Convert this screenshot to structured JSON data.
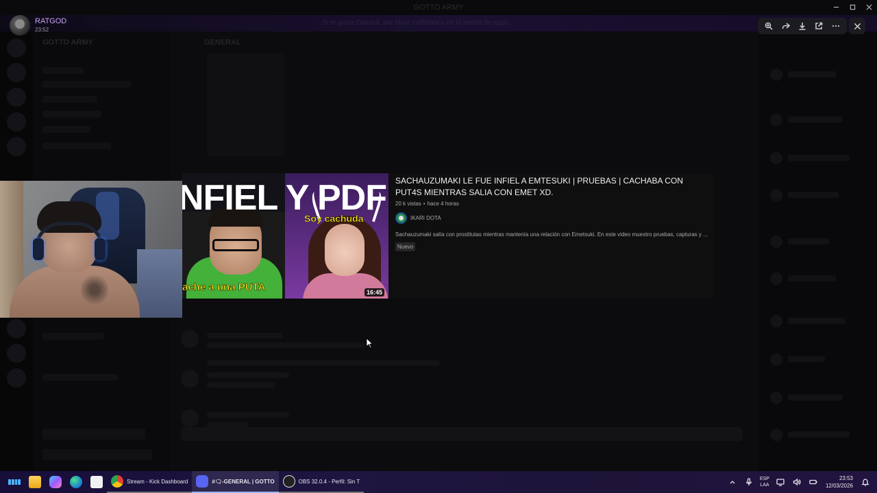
{
  "window": {
    "app_title": "GOTTO ARMY"
  },
  "background": {
    "server_name": "GOTTO ARMY",
    "channel_header": "GENERAL",
    "notice_text": "Si te gusta Discord, por favor calíficanos en la tienda de apps"
  },
  "viewer": {
    "username": "RATGOD",
    "time": "23:52",
    "toolbar": [
      "zoom-in-icon",
      "forward-icon",
      "download-icon",
      "open-external-icon",
      "more-icon"
    ]
  },
  "video": {
    "title": "SACHAUZUMAKI LE FUE INFIEL A EMTESUKI | PRUEBAS | CACHABA CON PUT4S MIENTRAS SALIA CON EMET XD.",
    "views": "20 k vistas",
    "separator": "•",
    "age": "hace 4 horas",
    "channel": "IKARI DOTA",
    "description": "Sachauzumaki salía con prostitutas mientras mantenía una relación con Emetsuki. En este video muestro pruebas, capturas y ...",
    "badge": "Nuevo",
    "duration": "16:45",
    "thumbnail": {
      "headline": "NFIEL Y PDF",
      "caption_left": "ache a una PUTA",
      "caption_right": "Soy cachuda"
    }
  },
  "taskbar": {
    "apps": [
      {
        "name": "file-explorer",
        "label": ""
      },
      {
        "name": "copilot",
        "label": ""
      },
      {
        "name": "edge",
        "label": ""
      },
      {
        "name": "store",
        "label": ""
      },
      {
        "name": "chrome",
        "label": "Stream - Kick Dashboard"
      },
      {
        "name": "discord",
        "label": "#🗨-GENERAL | GOTTO"
      },
      {
        "name": "obs",
        "label": "OBS 32.0.4 - Perfil: Sin T"
      }
    ],
    "language": "ESP",
    "language_sub": "LAA",
    "clock_time": "23:53",
    "clock_date": "12/03/2026"
  },
  "colors": {
    "username": "#c9a3f5",
    "taskbar_accent": "#9fb4ff",
    "video_card_bg": "#0f0f0f"
  }
}
